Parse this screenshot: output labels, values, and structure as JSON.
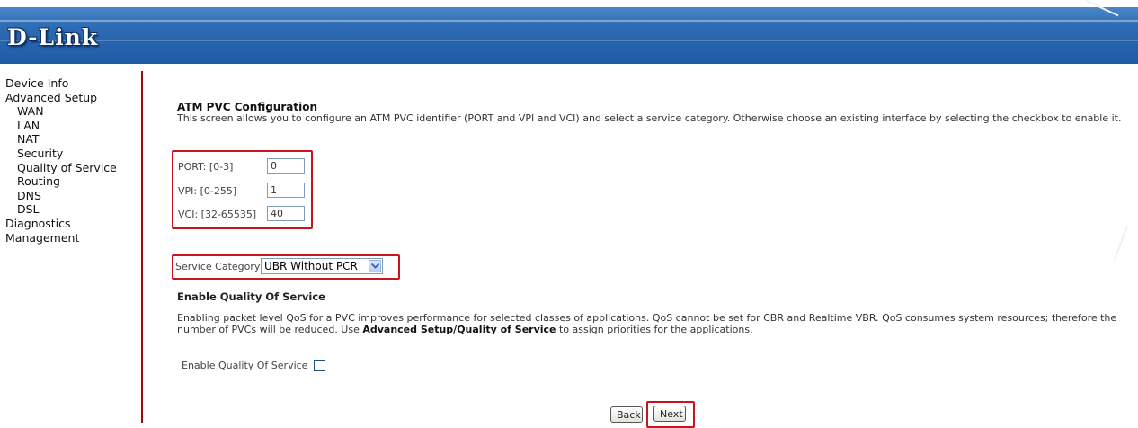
{
  "header": {
    "logo_text": "D-Link",
    "brand_color": "#2d6cb5"
  },
  "sidebar": {
    "items": [
      {
        "label": "Device Info",
        "level": 0
      },
      {
        "label": "Advanced Setup",
        "level": 0
      },
      {
        "label": "WAN",
        "level": 1
      },
      {
        "label": "LAN",
        "level": 1
      },
      {
        "label": "NAT",
        "level": 1
      },
      {
        "label": "Security",
        "level": 1
      },
      {
        "label": "Quality of Service",
        "level": 1
      },
      {
        "label": "Routing",
        "level": 1
      },
      {
        "label": "DNS",
        "level": 1
      },
      {
        "label": "DSL",
        "level": 1
      },
      {
        "label": "Diagnostics",
        "level": 0
      },
      {
        "label": "Management",
        "level": 0
      }
    ]
  },
  "main": {
    "title": "ATM PVC Configuration",
    "description": "This screen allows you to configure an ATM PVC identifier (PORT and VPI and VCI) and select a service category. Otherwise choose an existing interface by selecting the checkbox to enable it.",
    "port": {
      "label": "PORT: [0-3]",
      "value": "0"
    },
    "vpi": {
      "label": "VPI: [0-255]",
      "value": "1"
    },
    "vci": {
      "label": "VCI: [32-65535]",
      "value": "40"
    },
    "service_category": {
      "label": "Service Category:",
      "selected": "UBR Without PCR"
    },
    "qos": {
      "heading": "Enable Quality Of Service",
      "para_1": "Enabling packet level QoS for a PVC improves performance for selected classes of applications.  QoS cannot be set for CBR and Realtime VBR.  QoS consumes system resources; therefore the number of PVCs will be reduced. Use ",
      "para_bold": "Advanced Setup/Quality of Service",
      "para_2": " to assign priorities for the applications.",
      "checkbox_label": "Enable Quality Of Service",
      "checked": false
    },
    "buttons": {
      "back": "Back",
      "next": "Next"
    },
    "highlight_color": "#c8141c"
  }
}
